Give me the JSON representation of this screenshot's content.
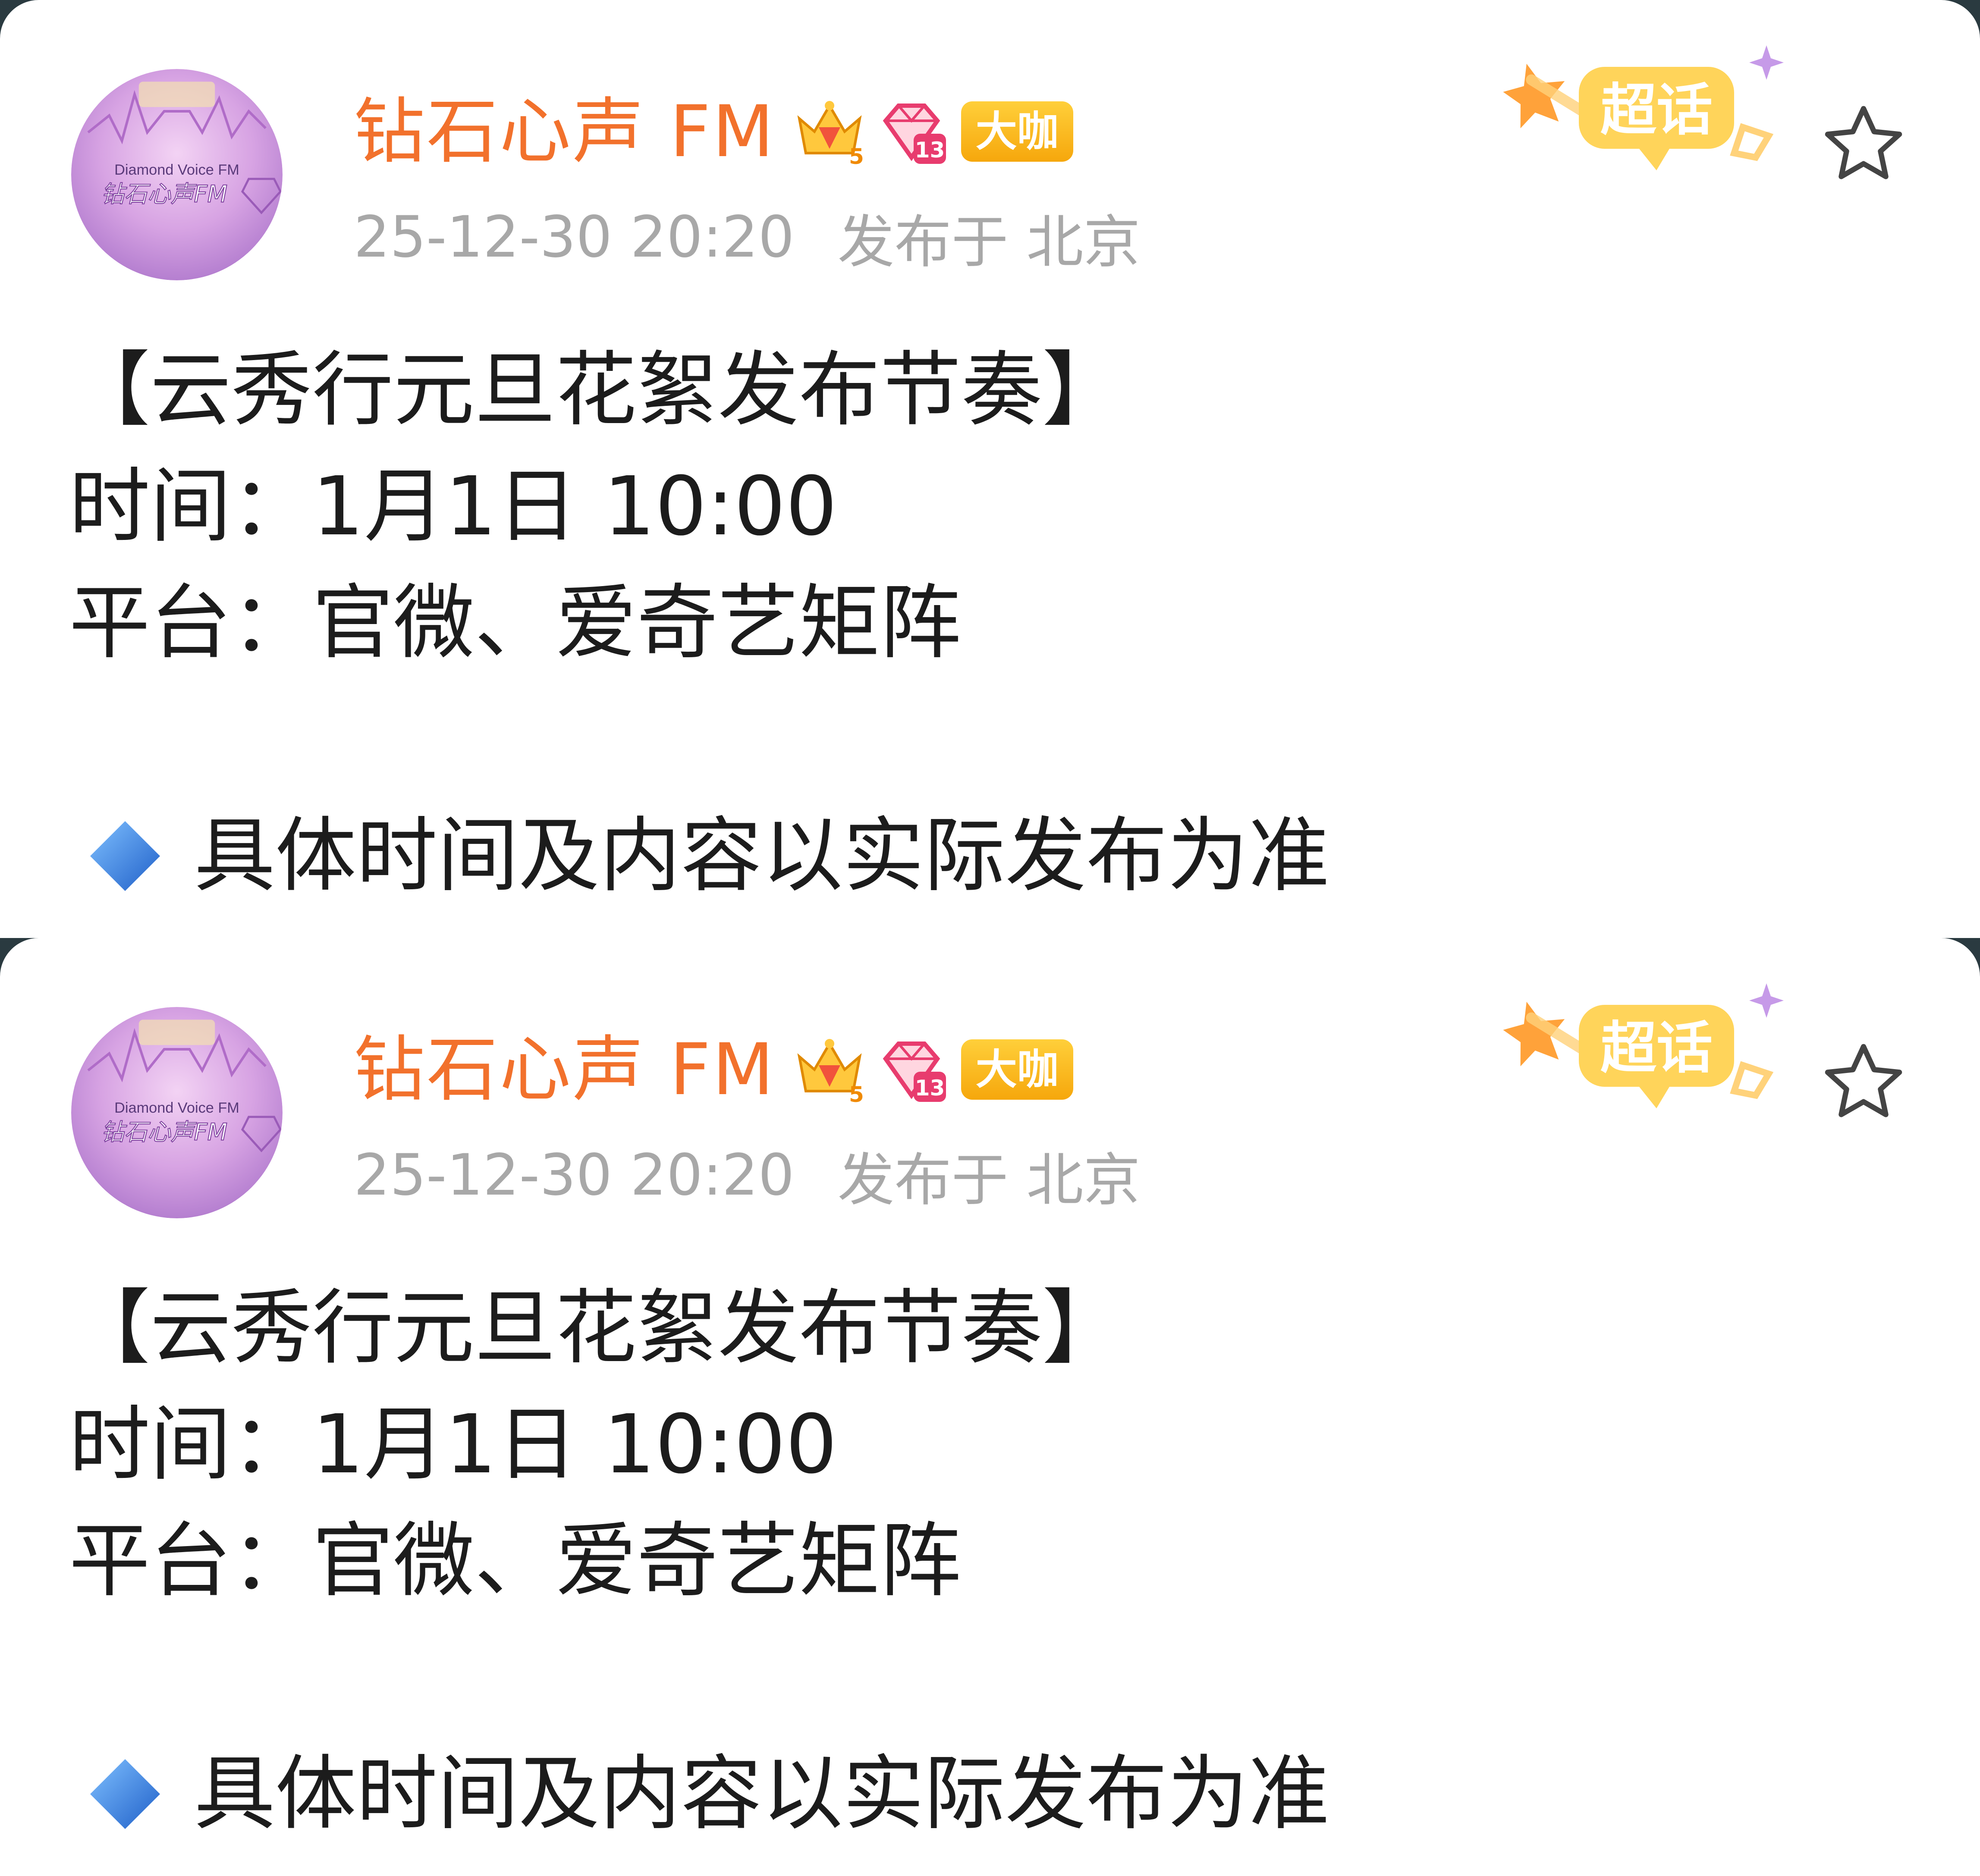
{
  "posts": [
    {
      "user": {
        "name": "钻石心声 FM",
        "avatar_text_en": "Diamond Voice FM",
        "avatar_text_cn": "钻石心声FM",
        "vip_badge": "大咖",
        "crown_level": "5",
        "gem_level": "13"
      },
      "meta": {
        "time": "25-12-30 20:20",
        "location": "发布于 北京"
      },
      "supertopic_label": "超话",
      "content": {
        "title": "【云秀行元旦花絮发布节奏】",
        "time_line": "时间：1月1日 10:00",
        "platform_line": "平台：官微、爱奇艺矩阵",
        "note": "具体时间及内容以实际发布为准"
      }
    },
    {
      "user": {
        "name": "钻石心声 FM",
        "avatar_text_en": "Diamond Voice FM",
        "avatar_text_cn": "钻石心声FM",
        "vip_badge": "大咖",
        "crown_level": "5",
        "gem_level": "13"
      },
      "meta": {
        "time": "25-12-30 20:20",
        "location": "发布于 北京"
      },
      "supertopic_label": "超话",
      "content": {
        "title": "【云秀行元旦花絮发布节奏】",
        "time_line": "时间：1月1日 10:00",
        "platform_line": "平台：官微、爱奇艺矩阵",
        "note": "具体时间及内容以实际发布为准"
      }
    }
  ],
  "colors": {
    "username": "#f2712c",
    "meta": "#a8a8a8",
    "text": "#1c1c1c",
    "badge": "#f6a70c",
    "diamond": "#2f7fe0",
    "avatar": "#d7a3e3"
  },
  "icons": [
    "avatar",
    "crown-icon",
    "gem-icon",
    "supertopic-icon",
    "star-icon",
    "diamond-icon"
  ]
}
